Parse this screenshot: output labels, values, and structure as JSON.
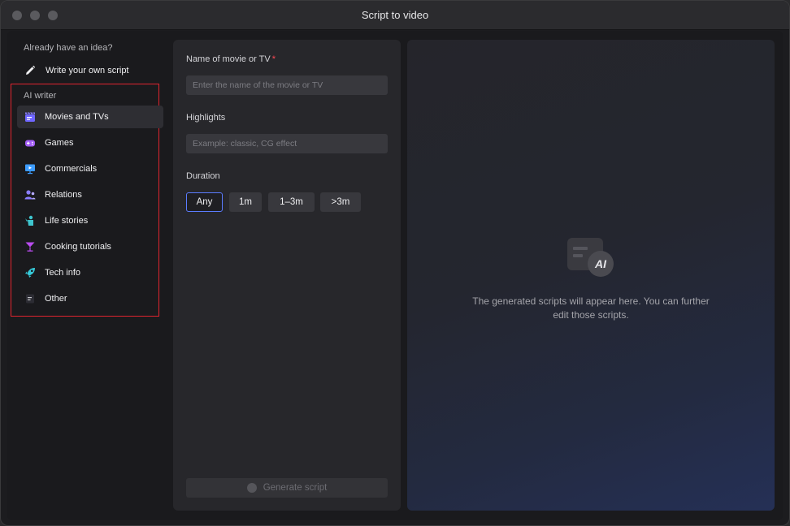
{
  "window": {
    "title": "Script to video"
  },
  "sidebar": {
    "idea_label": "Already have an idea?",
    "write_own": "Write your own script",
    "ai_writer_label": "AI writer",
    "items": [
      {
        "label": "Movies and TVs",
        "icon": "clapperboard-icon",
        "color": "#7b6cff",
        "active": true
      },
      {
        "label": "Games",
        "icon": "gamepad-icon",
        "color": "#a25cf5"
      },
      {
        "label": "Commercials",
        "icon": "presentation-icon",
        "color": "#3d9cff"
      },
      {
        "label": "Relations",
        "icon": "people-icon",
        "color": "#8a7dff"
      },
      {
        "label": "Life stories",
        "icon": "person-icon",
        "color": "#3ec6cf"
      },
      {
        "label": "Cooking tutorials",
        "icon": "cocktail-icon",
        "color": "#b94cf0"
      },
      {
        "label": "Tech info",
        "icon": "rocket-icon",
        "color": "#36c9d8"
      },
      {
        "label": "Other",
        "icon": "document-icon",
        "color": "#b0b0b6"
      }
    ]
  },
  "form": {
    "name_label": "Name of movie or TV",
    "required_mark": "*",
    "name_placeholder": "Enter the name of the movie or TV",
    "highlights_label": "Highlights",
    "highlights_placeholder": "Example: classic, CG effect",
    "duration_label": "Duration",
    "durations": [
      "Any",
      "1m",
      "1–3m",
      ">3m"
    ],
    "selected_duration": "Any",
    "generate_label": "Generate script"
  },
  "preview": {
    "logo_text": "AI",
    "empty_line1": "The generated scripts will appear here. You can further",
    "empty_line2": "edit those scripts."
  },
  "colors": {
    "accent": "#5b7cff",
    "required": "#ff4a55",
    "highlight_box": "#e0242f"
  }
}
